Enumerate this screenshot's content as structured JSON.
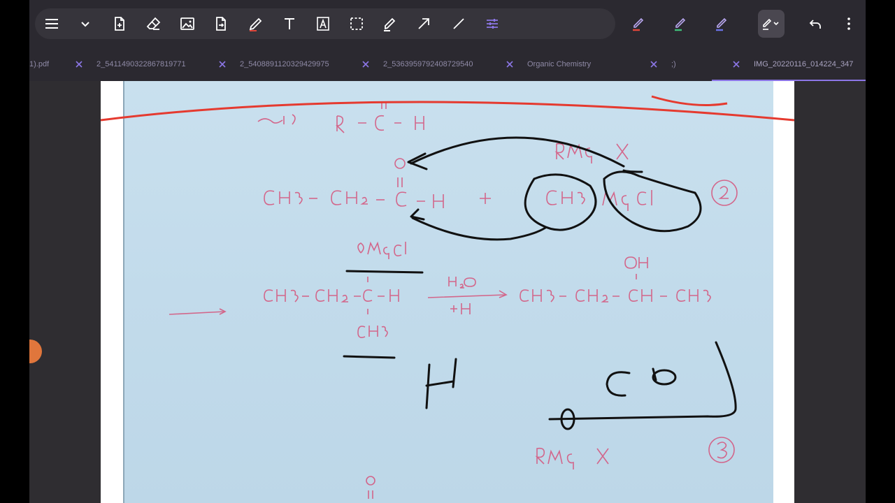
{
  "colors": {
    "app_bg": "#2b2930",
    "toolbar_pill": "#36343b",
    "icon": "#ffffff",
    "accent_purple": "#8c76e6",
    "pen_red": "#e0463a",
    "pen_green": "#3fbf7a",
    "pen_blue": "#6a72e8",
    "ink_red": "#e53a2f",
    "ink_black": "#111111",
    "ink_pink": "#d6527a"
  },
  "toolbar": {
    "tools": [
      {
        "name": "menu-icon"
      },
      {
        "name": "chevron-down-icon"
      },
      {
        "name": "add-page-icon"
      },
      {
        "name": "eraser-icon"
      },
      {
        "name": "image-icon"
      },
      {
        "name": "export-file-icon"
      },
      {
        "name": "pen-icon"
      },
      {
        "name": "text-icon"
      },
      {
        "name": "text-box-icon"
      },
      {
        "name": "lasso-select-icon"
      },
      {
        "name": "highlighter-icon"
      },
      {
        "name": "arrow-icon"
      },
      {
        "name": "line-icon"
      },
      {
        "name": "settings-sliders-icon"
      }
    ],
    "pens": [
      "red-pen-icon",
      "green-pen-icon",
      "blue-pen-icon"
    ],
    "right_tools": [
      "pen-style-dropdown-icon",
      "undo-icon",
      "more-vertical-icon"
    ]
  },
  "tabs": [
    {
      "label": "1).pdf"
    },
    {
      "label": "2_5411490322867819771"
    },
    {
      "label": "2_5408891120329429975"
    },
    {
      "label": "2_5363959792408729540"
    },
    {
      "label": "Organic Chemistry"
    },
    {
      "label": ";)"
    },
    {
      "label": "IMG_20220116_014224_347",
      "active": true
    }
  ]
}
